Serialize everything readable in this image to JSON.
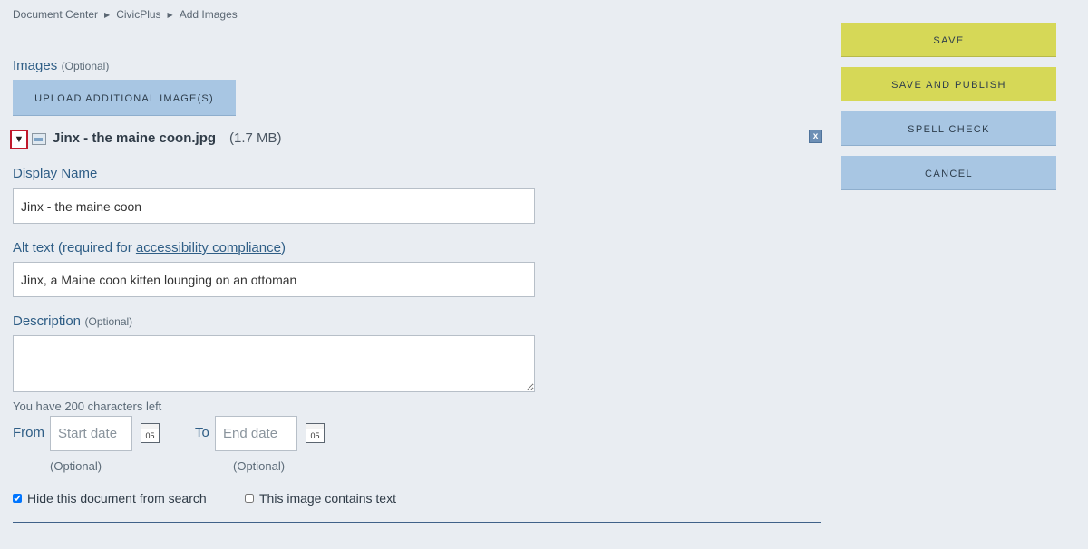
{
  "breadcrumb": [
    "Document Center",
    "CivicPlus",
    "Add Images"
  ],
  "images_section": {
    "title": "Images",
    "optional": "(Optional)",
    "upload_label": "UPLOAD ADDITIONAL IMAGE(S)"
  },
  "file": {
    "toggle_icon": "triangle-down-icon",
    "name": "Jinx - the maine coon.jpg",
    "size": "(1.7 MB)",
    "remove_label": "x"
  },
  "display_name": {
    "label": "Display Name",
    "value": "Jinx - the maine coon"
  },
  "alt_text": {
    "label_prefix": "Alt text (required for ",
    "link_text": "accessibility compliance",
    "label_suffix": ")",
    "value": "Jinx, a Maine coon kitten lounging on an ottoman"
  },
  "description": {
    "label": "Description",
    "optional": "(Optional)",
    "value": "",
    "chars_left": "You have 200 characters left"
  },
  "dates": {
    "from_label": "From",
    "from_placeholder": "Start date",
    "from_optional": "(Optional)",
    "to_label": "To",
    "to_placeholder": "End date",
    "to_optional": "(Optional)",
    "calendar_number": "05"
  },
  "options": {
    "hide_label": "Hide this document from search",
    "hide_checked": true,
    "contains_text_label": "This image contains text",
    "contains_text_checked": false
  },
  "actions": {
    "save": "SAVE",
    "save_publish": "SAVE AND PUBLISH",
    "spell_check": "SPELL CHECK",
    "cancel": "CANCEL"
  },
  "colors": {
    "accent_yellow": "#d6d857",
    "accent_blue": "#a8c6e3",
    "highlight_red": "#c0192b"
  }
}
